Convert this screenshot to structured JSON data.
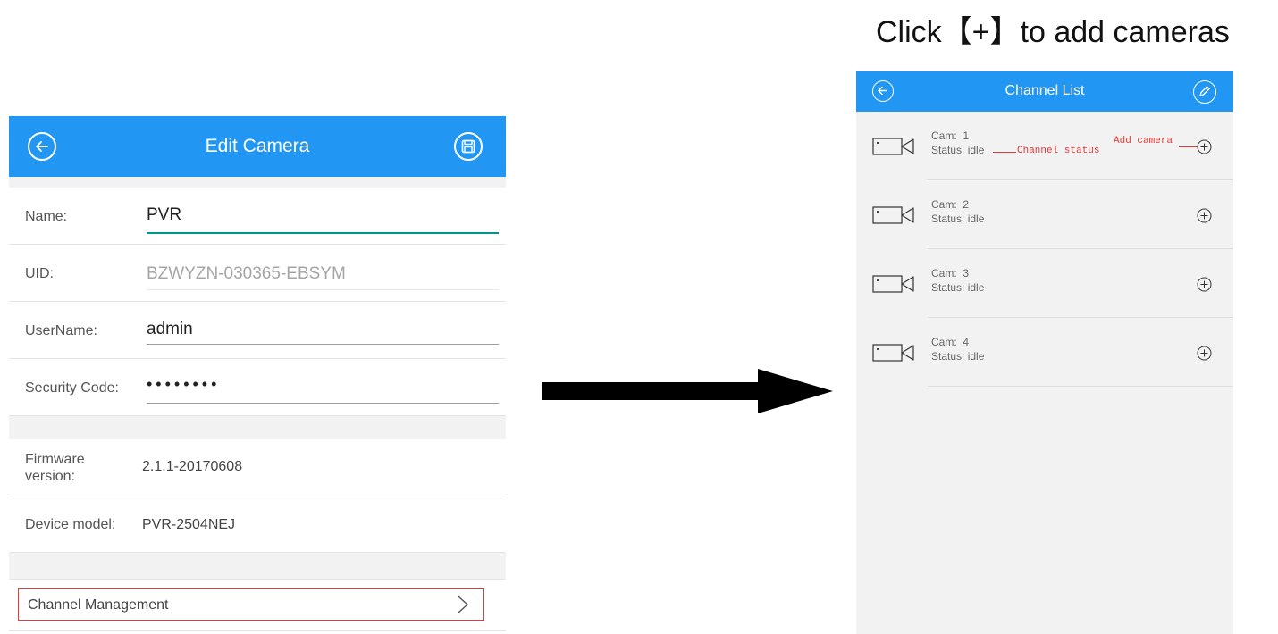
{
  "caption": "Click【+】to add cameras",
  "edit_camera": {
    "title": "Edit Camera",
    "fields": {
      "name": {
        "label": "Name:",
        "value": "PVR"
      },
      "uid": {
        "label": "UID:",
        "value": "BZWYZN-030365-EBSYM"
      },
      "username": {
        "label": "UserName:",
        "value": "admin"
      },
      "security_code": {
        "label": "Security Code:",
        "value": "••••••••"
      }
    },
    "firmware": {
      "label_line1": "Firmware",
      "label_line2": "version:",
      "value": "2.1.1-20170608"
    },
    "device_model": {
      "label": "Device model:",
      "value": "PVR-2504NEJ"
    },
    "channel_management": {
      "label": "Channel Management",
      "chevron": ">"
    }
  },
  "channel_list": {
    "title": "Channel List",
    "channels": [
      {
        "cam": "Cam:  1",
        "status": "Status: idle"
      },
      {
        "cam": "Cam:  2",
        "status": "Status: idle"
      },
      {
        "cam": "Cam:  3",
        "status": "Status: idle"
      },
      {
        "cam": "Cam:  4",
        "status": "Status: idle"
      }
    ],
    "annotations": {
      "channel_status": "Channel status",
      "add_camera": "Add camera"
    }
  },
  "icons": {
    "back": "back-arrow-circle-icon",
    "save": "save-disk-icon",
    "edit": "pencil-edit-icon",
    "camera": "video-camera-icon",
    "add": "plus-circle-icon"
  },
  "colors": {
    "header_blue": "#2196f3",
    "highlight_red": "#e53935",
    "focus_teal": "#009688"
  }
}
